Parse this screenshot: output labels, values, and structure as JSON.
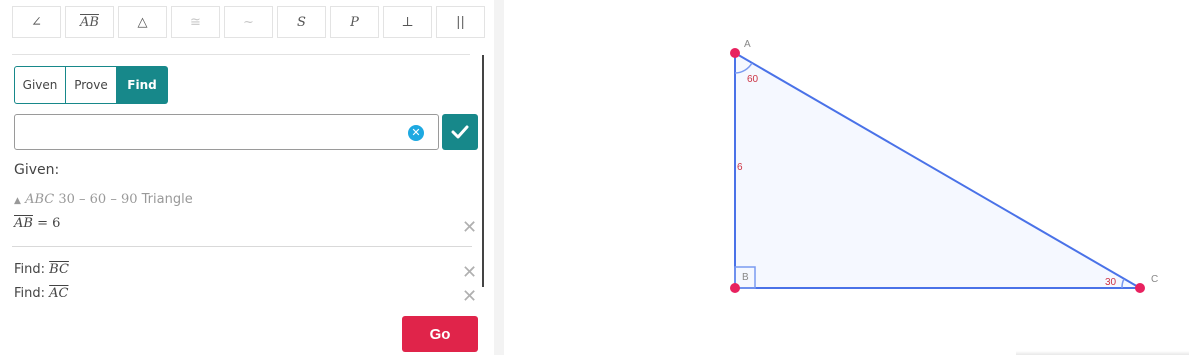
{
  "toolbar": {
    "buttons": [
      {
        "icon": "angle-icon",
        "label": "∠"
      },
      {
        "icon": "segment-icon",
        "label": "AB"
      },
      {
        "icon": "triangle-icon",
        "label": "△"
      },
      {
        "icon": "congruent-icon",
        "label": "≅"
      },
      {
        "icon": "similar-icon",
        "label": "~"
      },
      {
        "icon": "s-icon",
        "label": "S"
      },
      {
        "icon": "p-icon",
        "label": "P"
      },
      {
        "icon": "perpendicular-icon",
        "label": "⊥"
      },
      {
        "icon": "parallel-icon",
        "label": "||"
      }
    ]
  },
  "tabs": {
    "given": "Given",
    "prove": "Prove",
    "find": "Find",
    "active": "Find"
  },
  "input": {
    "value": "",
    "placeholder": ""
  },
  "given": {
    "heading": "Given:",
    "triangle_symbol": "▲",
    "triangle_name": "ABC",
    "triangle_angles": "30 – 60 – 90",
    "triangle_word": "Triangle",
    "segment": "AB",
    "segment_value": "= 6"
  },
  "find": [
    {
      "prefix": "Find:",
      "segment": "BC"
    },
    {
      "prefix": "Find:",
      "segment": "AC"
    }
  ],
  "go_label": "Go",
  "diagram": {
    "vertices": {
      "A": "A",
      "B": "B",
      "C": "C"
    },
    "angle_a": "60",
    "angle_c": "30",
    "side_ab": "6",
    "colors": {
      "line": "#4a72e8",
      "point": "#e8215f",
      "label": "#cc3344",
      "fill": "#f5f8ff"
    }
  }
}
